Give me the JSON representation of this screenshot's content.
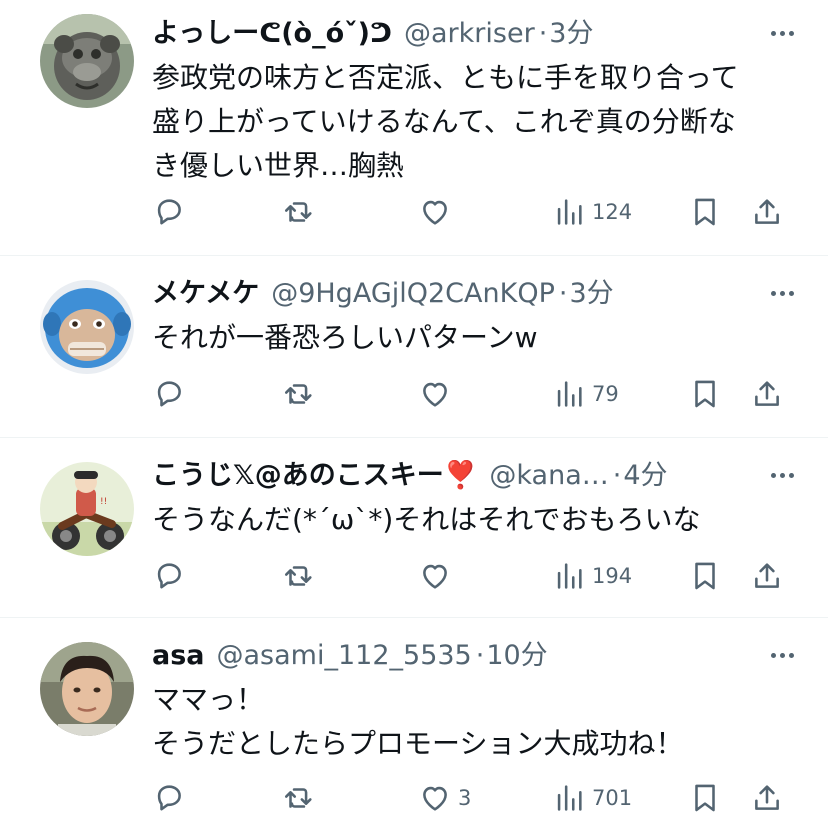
{
  "tweets": [
    {
      "name": "よっしーᕦ(ò_óˇ)ᕤ",
      "handle": "@arkriser",
      "sep": "·",
      "time": "3分",
      "lines": [
        "参政党の味方と否定派、ともに手を取り合って",
        "盛り上がっていけるなんて、これぞ真の分断な",
        "き優しい世界…胸熱"
      ],
      "likes": "",
      "views": "124",
      "avatar": "stone-monkey-statue"
    },
    {
      "name": "メケメケ",
      "handle": "@9HgAGjlQ2CAnKQP",
      "sep": "·",
      "time": "3分",
      "lines": [
        "それが一番恐ろしいパターンw"
      ],
      "likes": "",
      "views": "79",
      "avatar": "blue-monkey-face"
    },
    {
      "name": "こうじ𝕏@あのこスキー❣️",
      "handle": "@kana…",
      "sep": "·",
      "time": "4分",
      "lines": [
        "そうなんだ(*´ω`*)それはそれでおもろいな"
      ],
      "likes": "",
      "views": "194",
      "avatar": "cartoon-rider"
    },
    {
      "name": "asa",
      "handle": "@asami_112_5535",
      "sep": "·",
      "time": "10分",
      "lines": [
        "ママっ！",
        "そうだとしたらプロモーション大成功ね！"
      ],
      "likes": "3",
      "views": "701",
      "avatar": "person-photo"
    }
  ],
  "colors": {
    "text": "#0f1419",
    "muted": "#536471",
    "divider": "#eff3f4"
  }
}
